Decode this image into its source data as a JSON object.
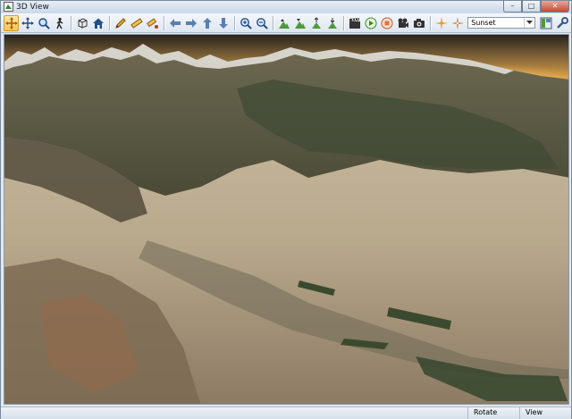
{
  "window": {
    "title": "3D View",
    "minimize": "–",
    "maximize": "□",
    "close": "✕"
  },
  "toolbar": {
    "scene_combo": {
      "selected": "Sunset"
    },
    "icons": [
      "pan-active-icon",
      "move-cross-icon",
      "zoom-icon",
      "walk-icon",
      "cube-icon",
      "home-icon",
      "pencil-icon",
      "measure-icon",
      "measure-point-icon",
      "back-arrow-icon",
      "forward-arrow-icon",
      "up-arrow-icon",
      "down-arrow-icon",
      "zoom-in-icon",
      "zoom-out-icon",
      "terrain-up-icon",
      "terrain-down-icon",
      "terrain-raise-icon",
      "terrain-lower-icon",
      "clapboard-icon",
      "play-icon",
      "stop-icon",
      "camera-video-icon",
      "photo-camera-icon",
      "sun-icon",
      "compass-icon",
      "layers-icon",
      "settings-wrench-icon"
    ]
  },
  "statusbar": {
    "mode": "Rotate",
    "view": "View"
  },
  "colors": {
    "accent": "#f7c453",
    "sky_top": "#2b2620",
    "sky_glow": "#e9a84a",
    "terrain": "#b9a88e"
  }
}
